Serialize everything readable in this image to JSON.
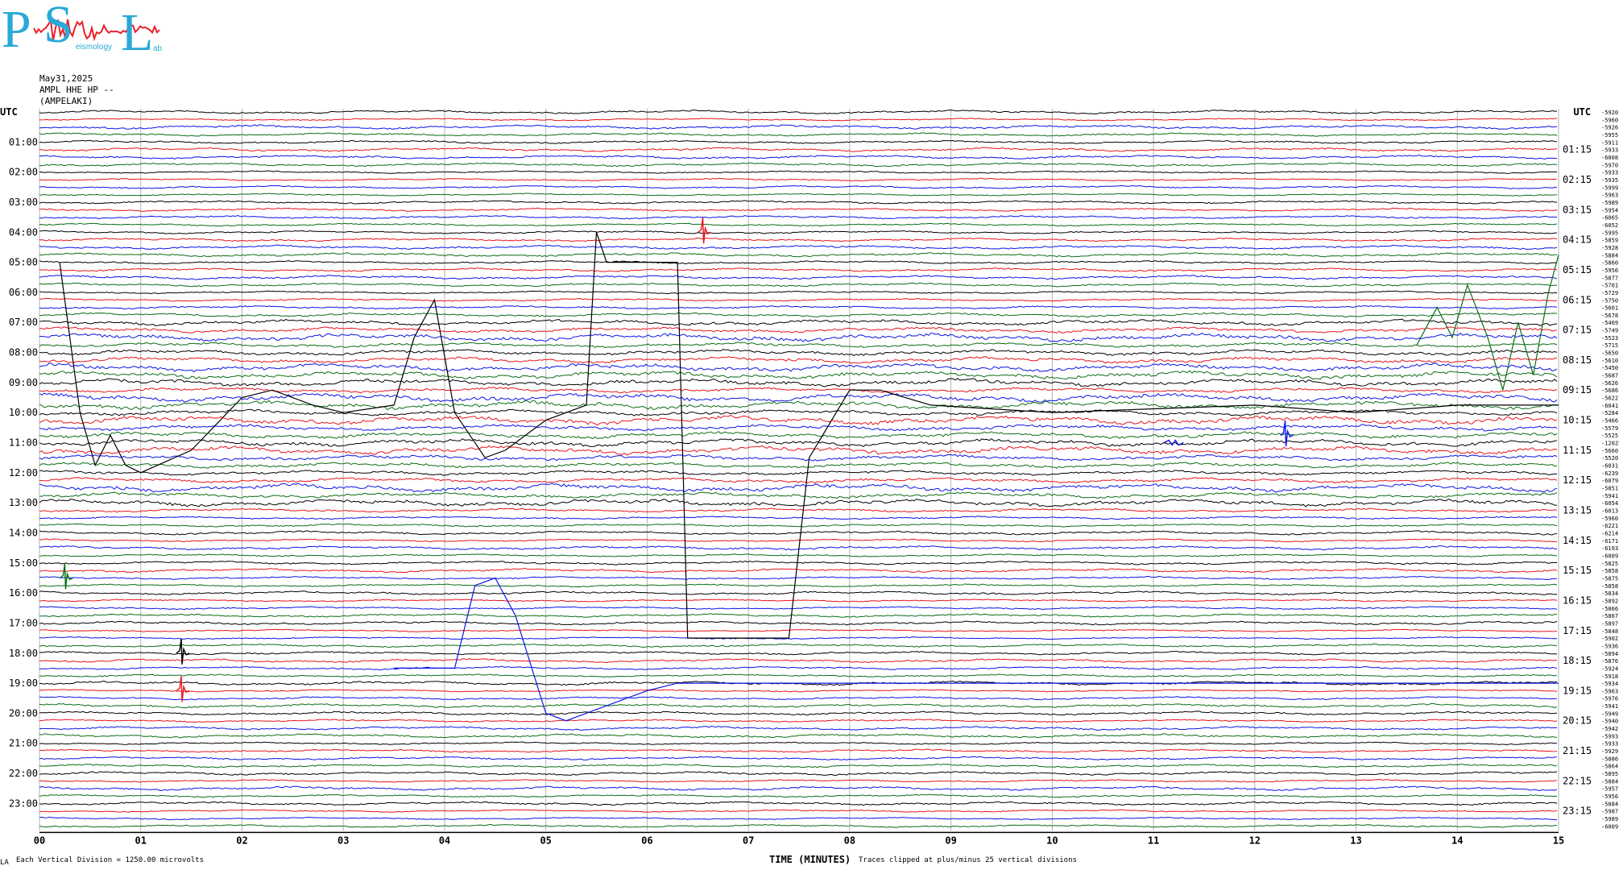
{
  "logo": {
    "letters": [
      "P",
      "S",
      "L"
    ],
    "subtitle": "eismology",
    "tail": "ab",
    "brand_color": "#29a9d6",
    "accent_color": "#e8202a"
  },
  "header": {
    "date": "May31,2025",
    "station": "AMPL HHE HP --",
    "location": "(AMPELAKI)"
  },
  "chart_data": {
    "type": "line",
    "title": "",
    "left_axis_label": "UTC",
    "right_axis_label": "UTC",
    "left_tick_labels": [
      "01:00",
      "02:00",
      "03:00",
      "04:00",
      "05:00",
      "06:00",
      "07:00",
      "08:00",
      "09:00",
      "10:00",
      "11:00",
      "12:00",
      "13:00",
      "14:00",
      "15:00",
      "16:00",
      "17:00",
      "18:00",
      "19:00",
      "20:00",
      "21:00",
      "22:00",
      "23:00"
    ],
    "right_tick_labels": [
      "01:15",
      "02:15",
      "03:15",
      "04:15",
      "05:15",
      "06:15",
      "07:15",
      "08:15",
      "09:15",
      "10:15",
      "11:15",
      "12:15",
      "13:15",
      "14:15",
      "15:15",
      "16:15",
      "17:15",
      "18:15",
      "19:15",
      "20:15",
      "21:15",
      "22:15",
      "23:15"
    ],
    "x_tick_labels": [
      "00",
      "01",
      "02",
      "03",
      "04",
      "05",
      "06",
      "07",
      "08",
      "09",
      "10",
      "11",
      "12",
      "13",
      "14",
      "15"
    ],
    "xlabel": "TIME (MINUTES)",
    "xlim": [
      0,
      15
    ],
    "trace_interval_minutes": 15,
    "trace_count": 96,
    "trace_colors": [
      "#000000",
      "#e8141e",
      "#0a14e6",
      "#0a6e14"
    ],
    "trace_offsets": [
      "-5920",
      "-5960",
      "-5926",
      "-5955",
      "-5911",
      "-5933",
      "-6008",
      "-5970",
      "-5933",
      "-5935",
      "-5999",
      "-5963",
      "-5989",
      "-5954",
      "-6065",
      "-6052",
      "-5995",
      "-5859",
      "-5928",
      "-5884",
      "-5860",
      "-5956",
      "-5877",
      "-5701",
      "-5729",
      "-5750",
      "-5601",
      "-5678",
      "-5469",
      "-5749",
      "-5523",
      "-5715",
      "-5650",
      "-5610",
      "-5450",
      "-5687",
      "-5626",
      "-5686",
      "-5622",
      "-6041",
      "-5284",
      "-5466",
      "-5579",
      "-5525",
      "-12025",
      "-5660",
      "-5520",
      "-6031",
      "-6239",
      "-6079",
      "-5851",
      "-5941",
      "-6054",
      "-6013",
      "-5960",
      "-6221",
      "-6214",
      "-6171",
      "-6193",
      "-6009",
      "-5825",
      "-5858",
      "-5875",
      "-5858",
      "-5834",
      "-5892",
      "-5866",
      "-5867",
      "-5897",
      "-5848",
      "-5902",
      "-5936",
      "-5894",
      "-5876",
      "-5924",
      "-5918",
      "-5934",
      "-5963",
      "-5976",
      "-5941",
      "-5949",
      "-5940",
      "-5942",
      "-5993",
      "-5933",
      "-5929",
      "-5886",
      "-5864",
      "-5895",
      "-5884",
      "-5957",
      "-5956",
      "-5884",
      "-5987",
      "-5989",
      "-6009"
    ],
    "events": [
      {
        "trace_time": "04:00",
        "minute": 6.55,
        "color": "red",
        "kind": "spike"
      },
      {
        "trace_time": "15:30",
        "minute": 0.25,
        "color": "green",
        "kind": "spike"
      },
      {
        "trace_time": "10:45",
        "minute": 12.3,
        "color": "blue",
        "kind": "spike"
      },
      {
        "trace_time": "11:00",
        "minute": 11.2,
        "color": "blue",
        "kind": "burst"
      },
      {
        "trace_time": "18:00",
        "minute": 1.4,
        "color": "black",
        "kind": "spike"
      },
      {
        "trace_time": "19:15",
        "minute": 1.4,
        "color": "red",
        "kind": "spike"
      }
    ]
  },
  "footer": {
    "division_note": "Each Vertical Division = 1250.00 microvolts",
    "clip_note": "Traces clipped at plus/minus 25 vertical divisions",
    "corner_mark": "LA"
  }
}
